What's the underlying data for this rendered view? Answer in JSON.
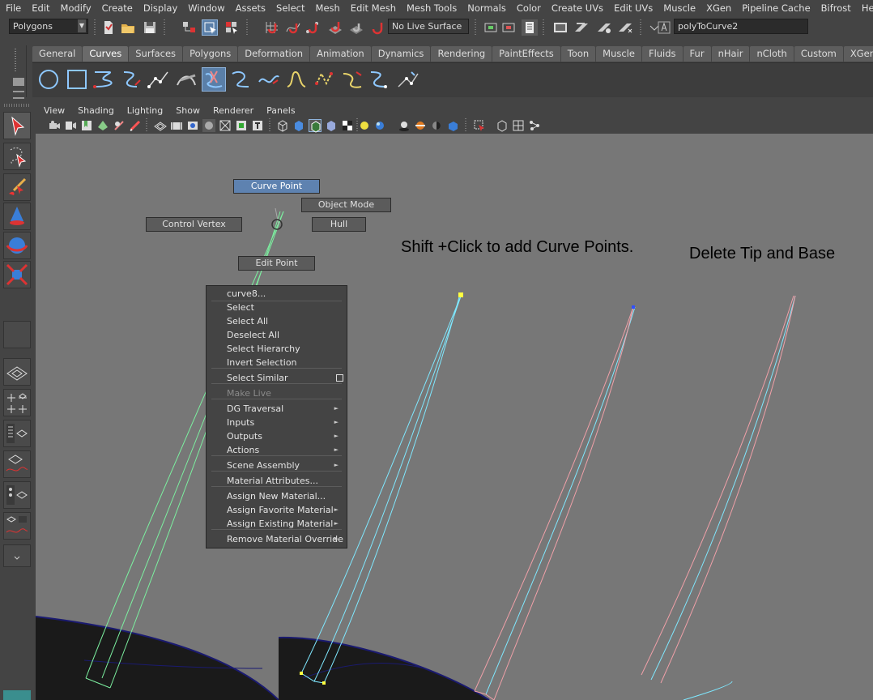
{
  "menu": [
    "File",
    "Edit",
    "Modify",
    "Create",
    "Display",
    "Window",
    "Assets",
    "Select",
    "Mesh",
    "Edit Mesh",
    "Mesh Tools",
    "Normals",
    "Color",
    "Create UVs",
    "Edit UVs",
    "Muscle",
    "XGen",
    "Pipeline Cache",
    "Bifrost",
    "Help"
  ],
  "status": {
    "menu_set": "Polygons",
    "live_surface": "No Live Surface",
    "name_field": "polyToCurve2"
  },
  "shelf_tabs": [
    "General",
    "Curves",
    "Surfaces",
    "Polygons",
    "Deformation",
    "Animation",
    "Dynamics",
    "Rendering",
    "PaintEffects",
    "Toon",
    "Muscle",
    "Fluids",
    "Fur",
    "nHair",
    "nCloth",
    "Custom",
    "XGen"
  ],
  "shelf_active": "Curves",
  "panel_menu": [
    "View",
    "Shading",
    "Lighting",
    "Show",
    "Renderer",
    "Panels"
  ],
  "marking_menu": {
    "north": "Curve Point",
    "northeast": "Object Mode",
    "west": "Control Vertex",
    "east": "Hull",
    "south": "Edit Point"
  },
  "context_menu": {
    "title": "curve8...",
    "items": [
      {
        "label": "Select",
        "submenu": false,
        "enabled": true
      },
      {
        "label": "Select All",
        "submenu": false,
        "enabled": true
      },
      {
        "label": "Deselect All",
        "submenu": false,
        "enabled": true
      },
      {
        "label": "Select Hierarchy",
        "submenu": false,
        "enabled": true
      },
      {
        "label": "Invert Selection",
        "submenu": false,
        "enabled": true
      },
      {
        "label": "Select Similar",
        "submenu": false,
        "enabled": true,
        "option_box": true
      },
      {
        "label": "Make Live",
        "submenu": false,
        "enabled": false
      },
      {
        "label": "DG Traversal",
        "submenu": true,
        "enabled": true
      },
      {
        "label": "Inputs",
        "submenu": true,
        "enabled": true
      },
      {
        "label": "Outputs",
        "submenu": true,
        "enabled": true
      },
      {
        "label": "Actions",
        "submenu": true,
        "enabled": true
      },
      {
        "label": "Scene Assembly",
        "submenu": true,
        "enabled": true
      },
      {
        "label": "Material Attributes...",
        "submenu": false,
        "enabled": true
      },
      {
        "label": "Assign New Material...",
        "submenu": false,
        "enabled": true
      },
      {
        "label": "Assign Favorite Material",
        "submenu": true,
        "enabled": true
      },
      {
        "label": "Assign Existing Material",
        "submenu": true,
        "enabled": true
      },
      {
        "label": "Remove Material Override",
        "submenu": true,
        "enabled": true
      }
    ]
  },
  "annotations": {
    "shift_click": "Shift +Click to add Curve Points.",
    "delete_tip": "Delete Tip and Base"
  },
  "colors": {
    "viewport_bg": "#777777",
    "highlight": "#5e82b0",
    "curve_green": "#7cf0a0",
    "curve_cyan": "#7fe8ff",
    "curve_pink": "#f0a0a8"
  }
}
